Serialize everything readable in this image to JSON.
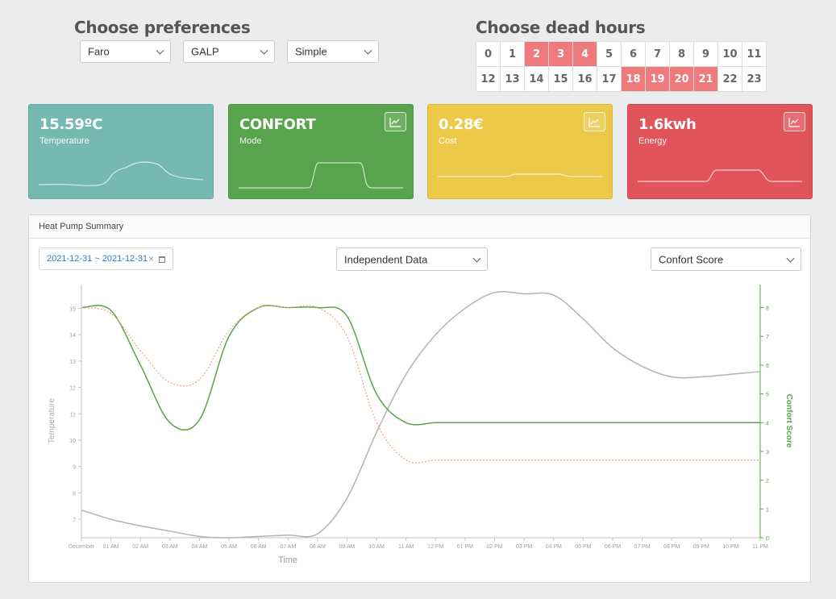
{
  "preferences": {
    "title": "Choose preferences",
    "location": "Faro",
    "supplier": "GALP",
    "tariff": "Simple"
  },
  "dead_hours": {
    "title": "Choose dead hours",
    "hours": [
      {
        "label": "0",
        "dead": false
      },
      {
        "label": "1",
        "dead": false
      },
      {
        "label": "2",
        "dead": true
      },
      {
        "label": "3",
        "dead": true
      },
      {
        "label": "4",
        "dead": true
      },
      {
        "label": "5",
        "dead": false
      },
      {
        "label": "6",
        "dead": false
      },
      {
        "label": "7",
        "dead": false
      },
      {
        "label": "8",
        "dead": false
      },
      {
        "label": "9",
        "dead": false
      },
      {
        "label": "10",
        "dead": false
      },
      {
        "label": "11",
        "dead": false
      },
      {
        "label": "12",
        "dead": false
      },
      {
        "label": "13",
        "dead": false
      },
      {
        "label": "14",
        "dead": false
      },
      {
        "label": "15",
        "dead": false
      },
      {
        "label": "16",
        "dead": false
      },
      {
        "label": "17",
        "dead": false
      },
      {
        "label": "18",
        "dead": true
      },
      {
        "label": "19",
        "dead": true
      },
      {
        "label": "20",
        "dead": true
      },
      {
        "label": "21",
        "dead": true
      },
      {
        "label": "22",
        "dead": false
      },
      {
        "label": "23",
        "dead": false
      }
    ]
  },
  "cards": {
    "temperature": {
      "value": "15.59ºC",
      "label": "Temperature",
      "color": "#76b8b2"
    },
    "mode": {
      "value": "CONFORT",
      "label": "Mode",
      "color": "#57a44c",
      "icon": "chart-line-icon"
    },
    "cost": {
      "value": "0.28€",
      "label": "Cost",
      "color": "#ecc948",
      "icon": "chart-line-icon"
    },
    "energy": {
      "value": "1.6kwh",
      "label": "Energy",
      "color": "#e1555a",
      "icon": "chart-line-icon"
    }
  },
  "summary": {
    "title": "Heat Pump Summary",
    "date_range": "2021-12-31 ~ 2021-12-31",
    "data_mode": "Independent Data",
    "metric": "Confort Score"
  },
  "chart_data": {
    "type": "line",
    "xlabel": "Time",
    "ylabel": "Temperature",
    "y2label": "Confort Score",
    "x": [
      "December",
      "01 AM",
      "02 AM",
      "03 AM",
      "04 AM",
      "05 AM",
      "06 AM",
      "07 AM",
      "08 AM",
      "09 AM",
      "10 AM",
      "11 AM",
      "12 PM",
      "01 PM",
      "02 PM",
      "03 PM",
      "04 PM",
      "05 PM",
      "06 PM",
      "07 PM",
      "08 PM",
      "09 PM",
      "10 PM",
      "11 PM"
    ],
    "ylim": [
      6.3,
      15.9
    ],
    "yticks": [
      7,
      8,
      9,
      10,
      11,
      12,
      13,
      14,
      15
    ],
    "y2lim": [
      0,
      8.8
    ],
    "y2ticks": [
      0,
      1,
      2,
      3,
      4,
      5,
      6,
      7,
      8
    ],
    "series": [
      {
        "axis": "left",
        "color": "#b9b1b1",
        "style": "solid",
        "values": [
          7.35,
          7.0,
          6.75,
          6.55,
          6.35,
          6.3,
          6.35,
          6.4,
          6.45,
          7.8,
          10.3,
          12.5,
          14.0,
          15.0,
          15.6,
          15.55,
          15.5,
          14.6,
          13.5,
          12.8,
          12.4,
          12.4,
          12.5,
          12.6
        ]
      },
      {
        "axis": "right",
        "color": "#5aa349",
        "style": "solid",
        "values": [
          8.0,
          7.9,
          6.0,
          4.0,
          4.1,
          7.0,
          8.0,
          8.0,
          8.0,
          7.7,
          5.0,
          4.0,
          4.0,
          4.0,
          4.0,
          4.0,
          4.0,
          4.0,
          4.0,
          4.0,
          4.0,
          4.0,
          4.0,
          4.0
        ]
      },
      {
        "axis": "right",
        "color": "#f4a27d",
        "style": "dashed",
        "values": [
          8.0,
          7.8,
          6.5,
          5.4,
          5.5,
          7.2,
          8.0,
          8.0,
          8.0,
          7.0,
          4.0,
          2.7,
          2.7,
          2.7,
          2.7,
          2.7,
          2.7,
          2.7,
          2.7,
          2.7,
          2.7,
          2.7,
          2.7,
          2.7
        ]
      }
    ]
  }
}
